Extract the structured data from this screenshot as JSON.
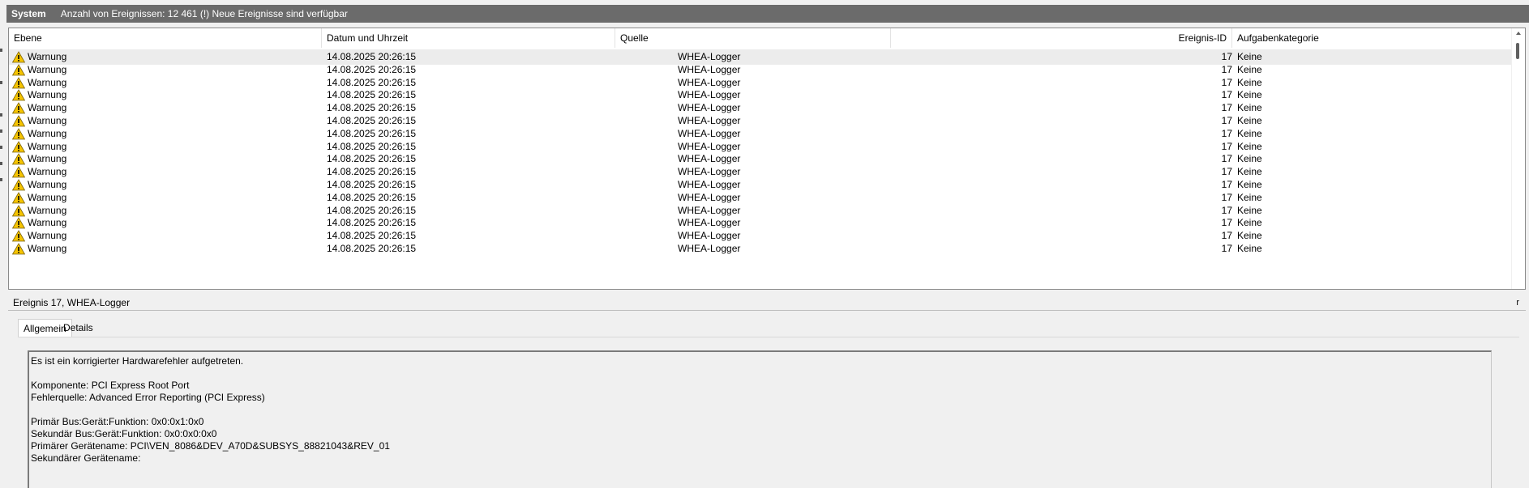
{
  "titlebar": {
    "log_name": "System",
    "summary": "Anzahl von Ereignissen: 12 461 (!) Neue Ereignisse sind verfügbar"
  },
  "list": {
    "columns": [
      "Ebene",
      "Datum und Uhrzeit",
      "Quelle",
      "Ereignis-ID",
      "Aufgabenkategorie"
    ],
    "rows": [
      {
        "level": "Warnung",
        "date": "14.08.2025 20:26:15",
        "source": "WHEA-Logger",
        "id": "17",
        "category": "Keine"
      },
      {
        "level": "Warnung",
        "date": "14.08.2025 20:26:15",
        "source": "WHEA-Logger",
        "id": "17",
        "category": "Keine"
      },
      {
        "level": "Warnung",
        "date": "14.08.2025 20:26:15",
        "source": "WHEA-Logger",
        "id": "17",
        "category": "Keine"
      },
      {
        "level": "Warnung",
        "date": "14.08.2025 20:26:15",
        "source": "WHEA-Logger",
        "id": "17",
        "category": "Keine"
      },
      {
        "level": "Warnung",
        "date": "14.08.2025 20:26:15",
        "source": "WHEA-Logger",
        "id": "17",
        "category": "Keine"
      },
      {
        "level": "Warnung",
        "date": "14.08.2025 20:26:15",
        "source": "WHEA-Logger",
        "id": "17",
        "category": "Keine"
      },
      {
        "level": "Warnung",
        "date": "14.08.2025 20:26:15",
        "source": "WHEA-Logger",
        "id": "17",
        "category": "Keine"
      },
      {
        "level": "Warnung",
        "date": "14.08.2025 20:26:15",
        "source": "WHEA-Logger",
        "id": "17",
        "category": "Keine"
      },
      {
        "level": "Warnung",
        "date": "14.08.2025 20:26:15",
        "source": "WHEA-Logger",
        "id": "17",
        "category": "Keine"
      },
      {
        "level": "Warnung",
        "date": "14.08.2025 20:26:15",
        "source": "WHEA-Logger",
        "id": "17",
        "category": "Keine"
      },
      {
        "level": "Warnung",
        "date": "14.08.2025 20:26:15",
        "source": "WHEA-Logger",
        "id": "17",
        "category": "Keine"
      },
      {
        "level": "Warnung",
        "date": "14.08.2025 20:26:15",
        "source": "WHEA-Logger",
        "id": "17",
        "category": "Keine"
      },
      {
        "level": "Warnung",
        "date": "14.08.2025 20:26:15",
        "source": "WHEA-Logger",
        "id": "17",
        "category": "Keine"
      },
      {
        "level": "Warnung",
        "date": "14.08.2025 20:26:15",
        "source": "WHEA-Logger",
        "id": "17",
        "category": "Keine"
      },
      {
        "level": "Warnung",
        "date": "14.08.2025 20:26:15",
        "source": "WHEA-Logger",
        "id": "17",
        "category": "Keine"
      },
      {
        "level": "Warnung",
        "date": "14.08.2025 20:26:15",
        "source": "WHEA-Logger",
        "id": "17",
        "category": "Keine"
      }
    ]
  },
  "detail": {
    "title": "Ereignis 17, WHEA-Logger",
    "close_label": "r",
    "tabs": [
      "Allgemein",
      "Details"
    ],
    "lines": [
      "Es ist ein korrigierter Hardwarefehler aufgetreten.",
      "",
      "Komponente: PCI Express Root Port",
      "Fehlerquelle: Advanced Error Reporting (PCI Express)",
      "",
      "Primär Bus:Gerät:Funktion: 0x0:0x1:0x0",
      "Sekundär Bus:Gerät:Funktion: 0x0:0x0:0x0",
      "Primärer Gerätename: PCI\\VEN_8086&DEV_A70D&SUBSYS_88821043&REV_01",
      "Sekundärer Gerätename:"
    ]
  },
  "colors": {
    "titlebar_bg": "#6b6b6b",
    "warning_icon": "#f5c400",
    "selected_row": "#ececec"
  },
  "icons": {
    "warning": "warning-triangle-icon"
  }
}
